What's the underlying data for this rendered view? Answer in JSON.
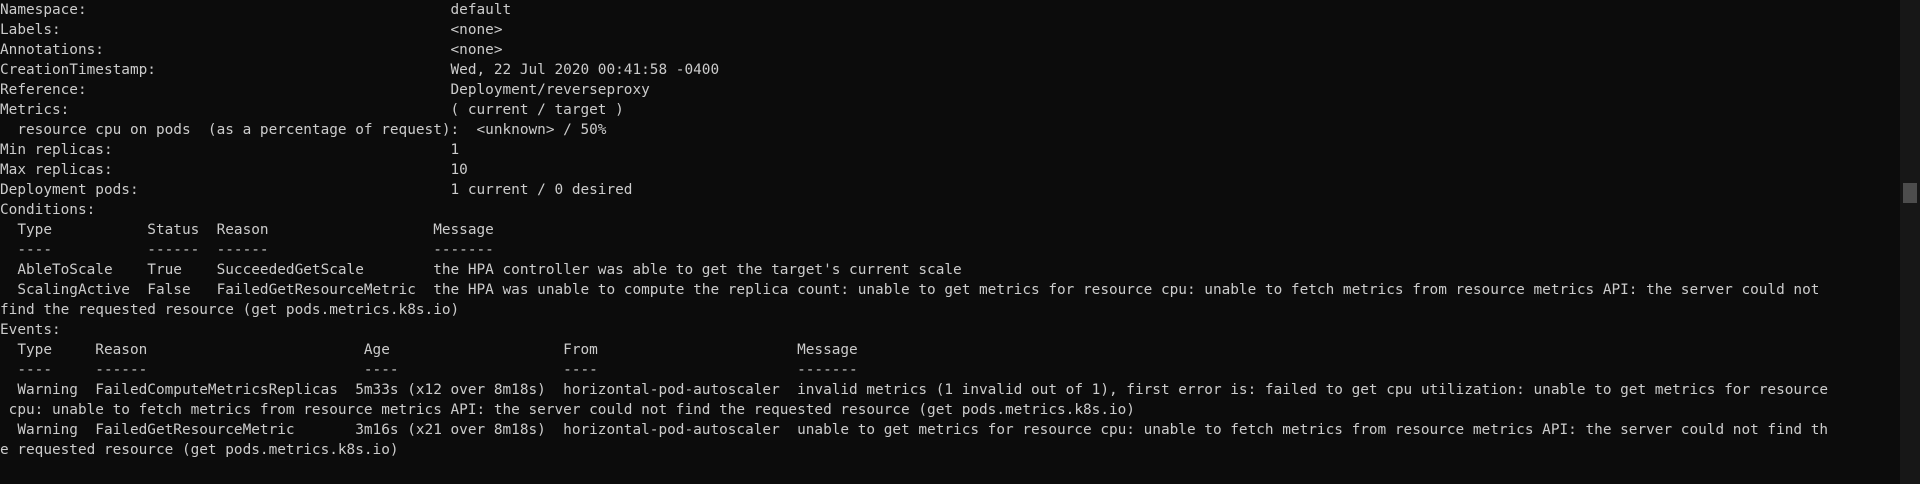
{
  "terminal": {
    "lines": [
      "Namespace:                                          default",
      "Labels:                                             <none>",
      "Annotations:                                        <none>",
      "CreationTimestamp:                                  Wed, 22 Jul 2020 00:41:58 -0400",
      "Reference:                                          Deployment/reverseproxy",
      "Metrics:                                            ( current / target )",
      "  resource cpu on pods  (as a percentage of request):  <unknown> / 50%",
      "Min replicas:                                       1",
      "Max replicas:                                       10",
      "Deployment pods:                                    1 current / 0 desired",
      "Conditions:",
      "  Type           Status  Reason                   Message",
      "  ----           ------  ------                   -------",
      "  AbleToScale    True    SucceededGetScale        the HPA controller was able to get the target's current scale",
      "  ScalingActive  False   FailedGetResourceMetric  the HPA was unable to compute the replica count: unable to get metrics for resource cpu: unable to fetch metrics from resource metrics API: the server could not",
      "find the requested resource (get pods.metrics.k8s.io)",
      "Events:",
      "  Type     Reason                         Age                    From                       Message",
      "  ----     ------                         ----                   ----                       -------",
      "  Warning  FailedComputeMetricsReplicas  5m33s (x12 over 8m18s)  horizontal-pod-autoscaler  invalid metrics (1 invalid out of 1), first error is: failed to get cpu utilization: unable to get metrics for resource",
      " cpu: unable to fetch metrics from resource metrics API: the server could not find the requested resource (get pods.metrics.k8s.io)",
      "  Warning  FailedGetResourceMetric       3m16s (x21 over 8m18s)  horizontal-pod-autoscaler  unable to get metrics for resource cpu: unable to fetch metrics from resource metrics API: the server could not find th",
      "e requested resource (get pods.metrics.k8s.io)"
    ]
  },
  "colors": {
    "background": "#0c0c0c",
    "text": "#cccccc",
    "scrollbar_track": "#171717",
    "scrollbar_thumb": "#4d4d4d"
  }
}
